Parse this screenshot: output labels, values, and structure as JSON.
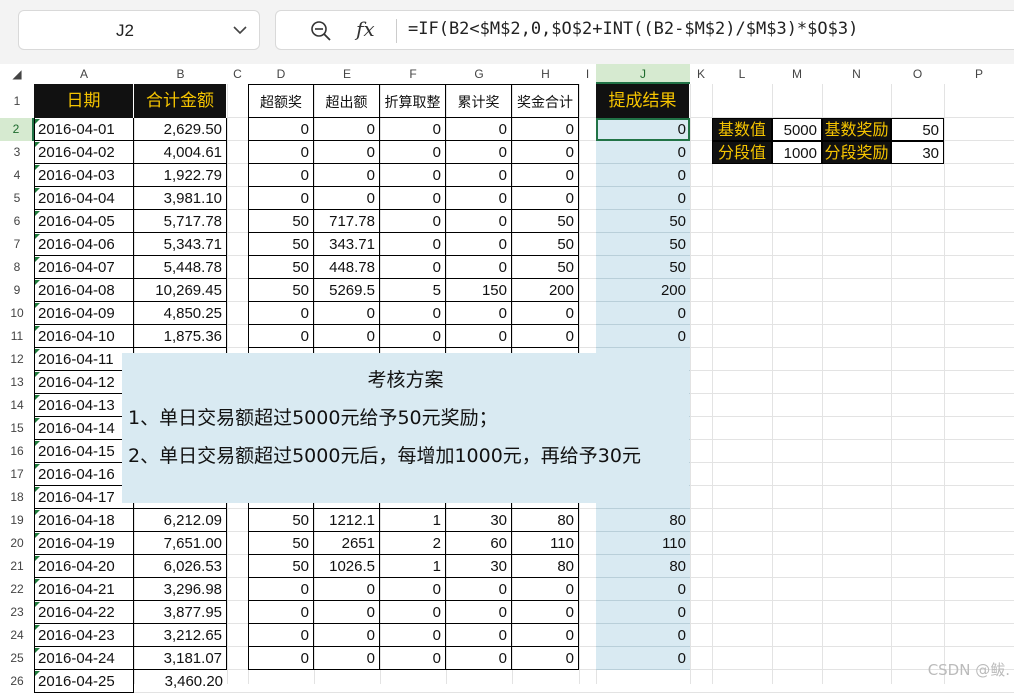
{
  "name_box": "J2",
  "formula": "=IF(B2<$M$2,0,$O$2+INT((B2-$M$2)/$M$3)*$O$3)",
  "fx_label": "fx",
  "columns": [
    "A",
    "B",
    "C",
    "D",
    "E",
    "F",
    "G",
    "H",
    "I",
    "J",
    "K",
    "L",
    "M",
    "N",
    "O",
    "P"
  ],
  "headers": {
    "A": "日期",
    "B": "合计金额",
    "D": "超额奖",
    "E": "超出额",
    "F": "折算取整",
    "G": "累计奖",
    "H": "奖金合计",
    "J": "提成结果"
  },
  "rows": [
    {
      "n": "2",
      "date": "2016-04-01",
      "amt": "2,629.50",
      "d": "0",
      "e": "0",
      "f": "0",
      "g": "0",
      "h": "0",
      "j": "0"
    },
    {
      "n": "3",
      "date": "2016-04-02",
      "amt": "4,004.61",
      "d": "0",
      "e": "0",
      "f": "0",
      "g": "0",
      "h": "0",
      "j": "0"
    },
    {
      "n": "4",
      "date": "2016-04-03",
      "amt": "1,922.79",
      "d": "0",
      "e": "0",
      "f": "0",
      "g": "0",
      "h": "0",
      "j": "0"
    },
    {
      "n": "5",
      "date": "2016-04-04",
      "amt": "3,981.10",
      "d": "0",
      "e": "0",
      "f": "0",
      "g": "0",
      "h": "0",
      "j": "0"
    },
    {
      "n": "6",
      "date": "2016-04-05",
      "amt": "5,717.78",
      "d": "50",
      "e": "717.78",
      "f": "0",
      "g": "0",
      "h": "50",
      "j": "50"
    },
    {
      "n": "7",
      "date": "2016-04-06",
      "amt": "5,343.71",
      "d": "50",
      "e": "343.71",
      "f": "0",
      "g": "0",
      "h": "50",
      "j": "50"
    },
    {
      "n": "8",
      "date": "2016-04-07",
      "amt": "5,448.78",
      "d": "50",
      "e": "448.78",
      "f": "0",
      "g": "0",
      "h": "50",
      "j": "50"
    },
    {
      "n": "9",
      "date": "2016-04-08",
      "amt": "10,269.45",
      "d": "50",
      "e": "5269.5",
      "f": "5",
      "g": "150",
      "h": "200",
      "j": "200"
    },
    {
      "n": "10",
      "date": "2016-04-09",
      "amt": "4,850.25",
      "d": "0",
      "e": "0",
      "f": "0",
      "g": "0",
      "h": "0",
      "j": "0"
    },
    {
      "n": "11",
      "date": "2016-04-10",
      "amt": "1,875.36",
      "d": "0",
      "e": "0",
      "f": "0",
      "g": "0",
      "h": "0",
      "j": "0"
    },
    {
      "n": "12",
      "date": "2016-04-11",
      "amt": "",
      "d": "",
      "e": "",
      "f": "",
      "g": "",
      "h": "",
      "j": ""
    },
    {
      "n": "13",
      "date": "2016-04-12",
      "amt": "",
      "d": "",
      "e": "",
      "f": "",
      "g": "",
      "h": "",
      "j": ""
    },
    {
      "n": "14",
      "date": "2016-04-13",
      "amt": "",
      "d": "",
      "e": "",
      "f": "",
      "g": "",
      "h": "",
      "j": ""
    },
    {
      "n": "15",
      "date": "2016-04-14",
      "amt": "",
      "d": "",
      "e": "",
      "f": "",
      "g": "",
      "h": "",
      "j": ""
    },
    {
      "n": "16",
      "date": "2016-04-15",
      "amt": "",
      "d": "",
      "e": "",
      "f": "",
      "g": "",
      "h": "",
      "j": ""
    },
    {
      "n": "17",
      "date": "2016-04-16",
      "amt": "",
      "d": "",
      "e": "",
      "f": "",
      "g": "",
      "h": "",
      "j": ""
    },
    {
      "n": "18",
      "date": "2016-04-17",
      "amt": "",
      "d": "",
      "e": "",
      "f": "",
      "g": "",
      "h": "",
      "j": ""
    },
    {
      "n": "19",
      "date": "2016-04-18",
      "amt": "6,212.09",
      "d": "50",
      "e": "1212.1",
      "f": "1",
      "g": "30",
      "h": "80",
      "j": "80"
    },
    {
      "n": "20",
      "date": "2016-04-19",
      "amt": "7,651.00",
      "d": "50",
      "e": "2651",
      "f": "2",
      "g": "60",
      "h": "110",
      "j": "110"
    },
    {
      "n": "21",
      "date": "2016-04-20",
      "amt": "6,026.53",
      "d": "50",
      "e": "1026.5",
      "f": "1",
      "g": "30",
      "h": "80",
      "j": "80"
    },
    {
      "n": "22",
      "date": "2016-04-21",
      "amt": "3,296.98",
      "d": "0",
      "e": "0",
      "f": "0",
      "g": "0",
      "h": "0",
      "j": "0"
    },
    {
      "n": "23",
      "date": "2016-04-22",
      "amt": "3,877.95",
      "d": "0",
      "e": "0",
      "f": "0",
      "g": "0",
      "h": "0",
      "j": "0"
    },
    {
      "n": "24",
      "date": "2016-04-23",
      "amt": "3,212.65",
      "d": "0",
      "e": "0",
      "f": "0",
      "g": "0",
      "h": "0",
      "j": "0"
    },
    {
      "n": "25",
      "date": "2016-04-24",
      "amt": "3,181.07",
      "d": "0",
      "e": "0",
      "f": "0",
      "g": "0",
      "h": "0",
      "j": "0"
    },
    {
      "n": "26",
      "date": "2016-04-25",
      "amt": "3,460.20",
      "d": "",
      "e": "",
      "f": "",
      "g": "",
      "h": "",
      "j": ""
    }
  ],
  "params": {
    "base_label": "基数值",
    "base_value": "5000",
    "base_reward_label": "基数奖励",
    "base_reward": "50",
    "step_label": "分段值",
    "step_value": "1000",
    "step_reward_label": "分段奖励",
    "step_reward": "30"
  },
  "note": {
    "title": "考核方案",
    "line1": "1、单日交易额超过5000元给予50元奖励；",
    "line2": "2、单日交易额超过5000元后，每增加1000元，再给予30元"
  },
  "watermark": "CSDN @鲅."
}
